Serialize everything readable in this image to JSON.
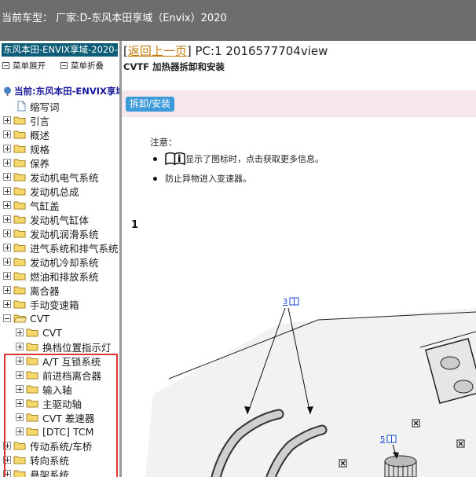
{
  "top_bar": {
    "title": "当前车型：  厂家:D-东风本田享域（Envix）2020"
  },
  "sidebar": {
    "header": "东风本田-ENVIX享域-2020-",
    "expand_label": "菜单展开",
    "collapse_label": "菜单折叠",
    "current_label": "当前:东风本田-ENVIX享域",
    "items": [
      {
        "label": "缩写词",
        "type": "doc"
      },
      {
        "label": "引言",
        "type": "folder"
      },
      {
        "label": "概述",
        "type": "folder"
      },
      {
        "label": "规格",
        "type": "folder"
      },
      {
        "label": "保养",
        "type": "folder"
      },
      {
        "label": "发动机电气系统",
        "type": "folder"
      },
      {
        "label": "发动机总成",
        "type": "folder"
      },
      {
        "label": "气缸盖",
        "type": "folder"
      },
      {
        "label": "发动机气缸体",
        "type": "folder"
      },
      {
        "label": "发动机润滑系统",
        "type": "folder"
      },
      {
        "label": "进气系统和排气系统",
        "type": "folder"
      },
      {
        "label": "发动机冷却系统",
        "type": "folder"
      },
      {
        "label": "燃油和排放系统",
        "type": "folder"
      },
      {
        "label": "离合器",
        "type": "folder"
      },
      {
        "label": "手动变速箱",
        "type": "folder"
      },
      {
        "label": "CVT",
        "type": "folder-open"
      },
      {
        "label": "CVT",
        "type": "child"
      },
      {
        "label": "换档位置指示灯",
        "type": "child"
      },
      {
        "label": "A/T 互锁系统",
        "type": "child"
      },
      {
        "label": "前进档离合器",
        "type": "child"
      },
      {
        "label": "输入轴",
        "type": "child"
      },
      {
        "label": "主驱动轴",
        "type": "child"
      },
      {
        "label": "CVT 差速器",
        "type": "child"
      },
      {
        "label": "[DTC] TCM",
        "type": "child"
      },
      {
        "label": "传动系统/车桥",
        "type": "folder"
      },
      {
        "label": "转向系统",
        "type": "folder"
      },
      {
        "label": "悬架系统",
        "type": "folder"
      }
    ]
  },
  "content": {
    "back_link": "返回上一页",
    "page_code": "PC:1 2016577704view",
    "title": "CVTF 加热器拆卸和安装",
    "tab_label": "拆卸/安装",
    "note_label": "注意：",
    "notes": [
      "显示了图标时，点击获取更多信息。",
      "防止异物进入变速器。"
    ],
    "step_number": "1",
    "callouts": [
      "3",
      "5"
    ]
  },
  "colors": {
    "top_bar": "#6d6d6d",
    "sidebar_header": "#0e5d78",
    "link": "#c47a0a",
    "tab_button": "#3c9bd9",
    "highlight_box": "#dd3333"
  }
}
